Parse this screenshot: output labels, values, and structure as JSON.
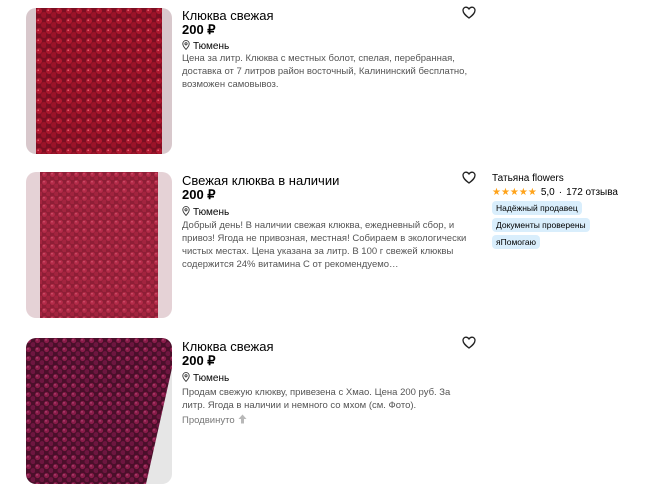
{
  "listings": [
    {
      "title": "Клюква свежая",
      "price": "200 ₽",
      "location": "Тюмень",
      "description": "Цена за литр. Клюква с местных болот, спелая, перебранная, доставка от 7 литров район восточный, Калининский бесплатно, возможен самовывоз."
    },
    {
      "title": "Свежая клюква в наличии",
      "price": "200 ₽",
      "location": "Тюмень",
      "description": "Добрый день! В наличии свежая клюква, ежедневный сбор, и привоз! Ягода не привозная, местная! Собираем в экологически чистых местах. Цена указана за литр. В 100 г свежей клюквы содержится 24% витамина С от рекомендуемо…"
    },
    {
      "title": "Клюква свежая",
      "price": "200 ₽",
      "location": "Тюмень",
      "description": "Продам свежую клюкву, привезена с Хмао. Цена 200 руб. За литр. Ягода в наличии и немного со мхом (см. Фото).",
      "promoted": "Продвинуто"
    }
  ],
  "seller": {
    "name": "Татьяна flowers",
    "rating": "5,0",
    "reviews": "172 отзыва",
    "badges": [
      "Надёжный продавец",
      "Документы проверены",
      "яПомогаю"
    ]
  },
  "icons": {
    "favorite": "heart-outline-icon",
    "location": "map-pin-icon",
    "promoted": "arrow-up-icon",
    "stars": "star-icon"
  },
  "colors": {
    "star": "#ffa31a",
    "badge_bg": "#d9eefc",
    "description_text": "#555555"
  }
}
